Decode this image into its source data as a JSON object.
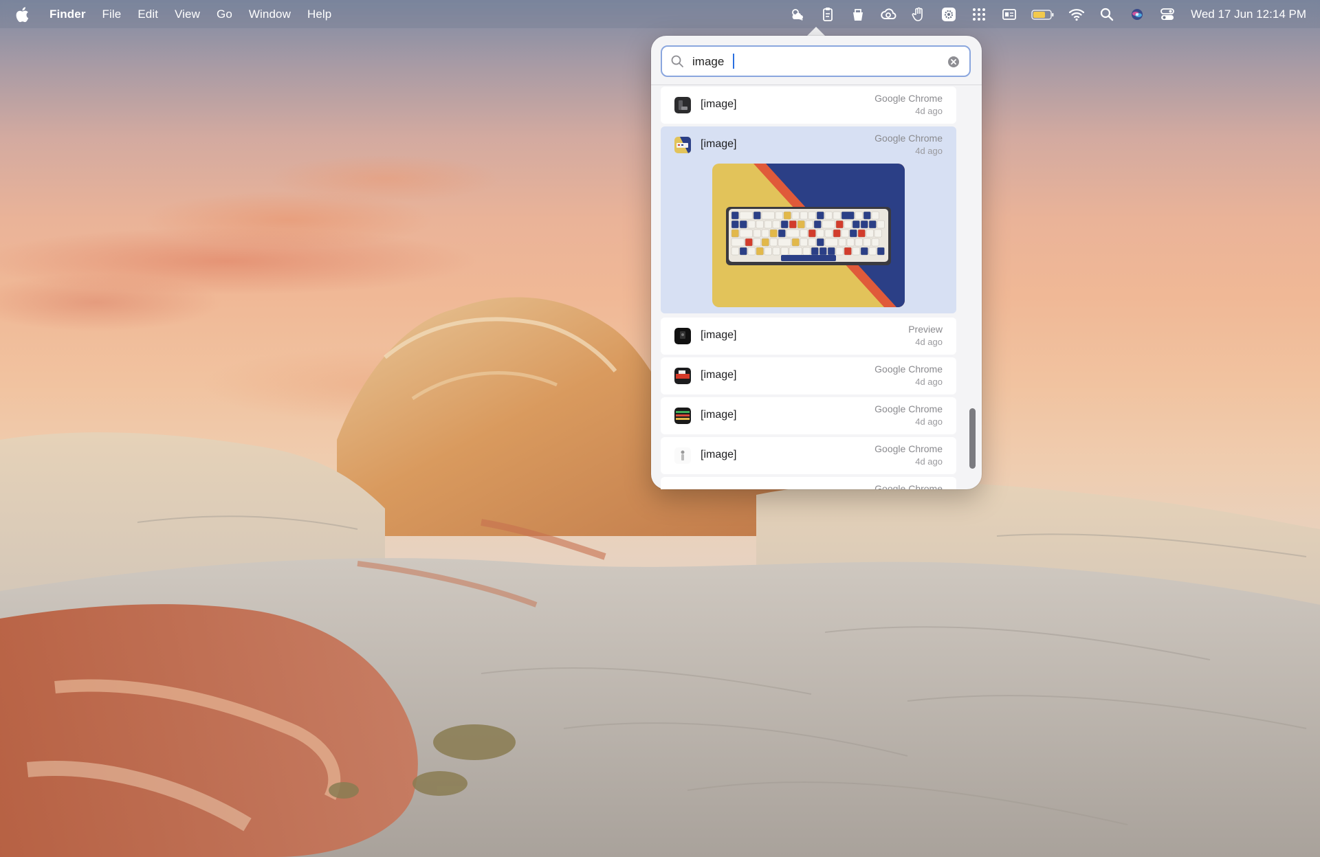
{
  "menubar": {
    "menus": [
      "Finder",
      "File",
      "Edit",
      "View",
      "Go",
      "Window",
      "Help"
    ],
    "tray_icons": [
      "weather-icon",
      "clipboard-icon",
      "bucket-icon",
      "creative-cloud-icon",
      "hand-icon",
      "gear-badge-icon",
      "grid-icon",
      "display-icon",
      "battery-icon",
      "wifi-icon",
      "spotlight-search-icon",
      "siri-icon",
      "control-center-icon"
    ],
    "battery_color": "#f2c94c",
    "clock": "Wed 17 Jun  12:14 PM"
  },
  "clipboard_popover": {
    "search": {
      "value": "image",
      "focus_color": "#8aa6de"
    },
    "items": [
      {
        "label": "[image]",
        "app": "Google Chrome",
        "time": "4d ago",
        "selected": false,
        "thumb": "dark-device"
      },
      {
        "label": "[image]",
        "app": "Google Chrome",
        "time": "4d ago",
        "selected": true,
        "thumb": "keyboard"
      },
      {
        "label": "[image]",
        "app": "Preview",
        "time": "4d ago",
        "selected": false,
        "thumb": "black-square"
      },
      {
        "label": "[image]",
        "app": "Google Chrome",
        "time": "4d ago",
        "selected": false,
        "thumb": "red-black"
      },
      {
        "label": "[image]",
        "app": "Google Chrome",
        "time": "4d ago",
        "selected": false,
        "thumb": "colored-stripes"
      },
      {
        "label": "[image]",
        "app": "Google Chrome",
        "time": "4d ago",
        "selected": false,
        "thumb": "small-figure"
      },
      {
        "label": "",
        "app": "Google Chrome",
        "time": "",
        "selected": false,
        "thumb": ""
      }
    ],
    "selected_preview": "keyboard-photo",
    "selection_color": "#d7e0f3"
  }
}
